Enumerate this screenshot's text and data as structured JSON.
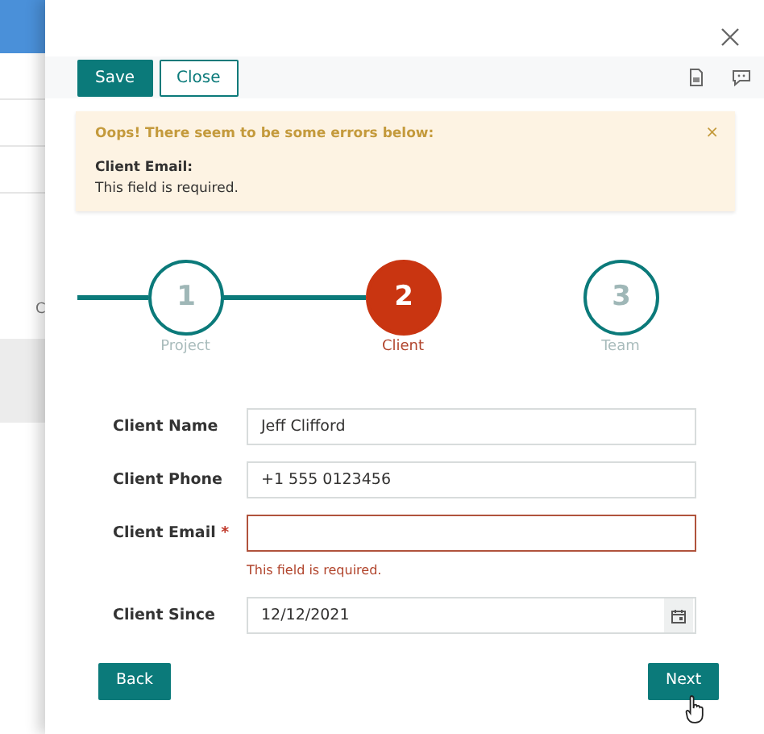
{
  "background": {
    "fragment": "C"
  },
  "toolbar": {
    "buttons": [
      {
        "label": "Save",
        "kind": "primary"
      },
      {
        "label": "Close",
        "kind": "outline"
      }
    ]
  },
  "alert": {
    "title": "Oops! There seem to be some errors below:",
    "close": "×",
    "field": "Client Email:",
    "message": "This field is required."
  },
  "steps": [
    {
      "number": "1",
      "label": "Project",
      "selected": false
    },
    {
      "number": "2",
      "label": "Client",
      "selected": true
    },
    {
      "number": "3",
      "label": "Team",
      "selected": false
    }
  ],
  "fields": [
    {
      "label": "Client Name",
      "kind": "text",
      "value": "Jeff Clifford",
      "invalid": false
    },
    {
      "label": "Client Phone",
      "kind": "text",
      "value": "+1 555 0123456",
      "invalid": false
    },
    {
      "label": "Client Email",
      "required_mark": "*",
      "kind": "text",
      "invalid": true,
      "error": "This field is required."
    },
    {
      "label": "Client Since",
      "kind": "date",
      "value": "12/12/2021",
      "invalid": false
    }
  ],
  "footer": {
    "back": "Back",
    "next": "Next"
  }
}
